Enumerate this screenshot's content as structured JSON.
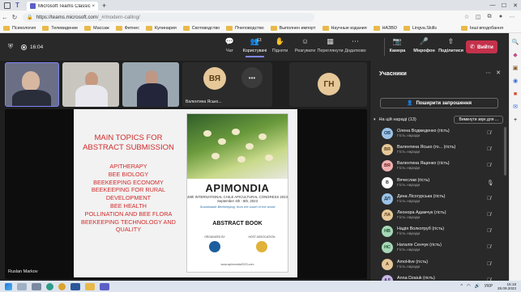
{
  "browser": {
    "tab_title": "Microsoft Teams Classic",
    "tab_close": "×",
    "new_tab": "+",
    "url_host": "https://teams.microsoft.com",
    "url_path": "/_#/modern-calling/",
    "bookmarks": [
      "Психология",
      "Телевидение",
      "Массаж",
      "Фитнес",
      "Кулинария",
      "Скотоводство",
      "Пчеловодство",
      "Выполнен импорт",
      "Научные издания",
      "НАЗВО",
      "Lingva.Skills"
    ],
    "bookmark_other": "Інші вподобання"
  },
  "meeting": {
    "timer": "16:04",
    "toolbar": [
      {
        "label": "Чат",
        "icon": "💬"
      },
      {
        "label": "Користувачі",
        "icon": "👥",
        "count": "13"
      },
      {
        "label": "Підняти",
        "icon": "✋"
      },
      {
        "label": "Реагувати",
        "icon": "☺"
      },
      {
        "label": "Переглянути",
        "icon": "▦"
      },
      {
        "label": "Додатково",
        "icon": "⋯"
      }
    ],
    "devices": [
      {
        "label": "Камера",
        "icon": "📷"
      },
      {
        "label": "Мікрофон",
        "icon": "🎤"
      },
      {
        "label": "Поділитися",
        "icon": "⇧"
      }
    ],
    "leave_label": "Вийти"
  },
  "stage": {
    "avatar_tile": {
      "initials": "ВЯ",
      "name": "Валентина Ясько..."
    },
    "more_tile": {
      "label": "•••",
      "caption": "Ще користувачі: 9 осіб"
    },
    "gn_tile": {
      "initials": "ГН"
    },
    "presenter": "Ruslan Markov"
  },
  "slide": {
    "title_line1": "MAIN TOPICS FOR",
    "title_line2": "ABSTRACT SUBMISSION",
    "topics": [
      "APITHERAPY",
      "BEE BIOLOGY",
      "BEEKEEPING ECONOMY",
      "BEEKEEPING FOR RURAL",
      "DEVELOPMENT",
      "BEE HEALTH",
      "POLLINATION AND BEE FLORA",
      "BEEKEEPING TECHNOLOGY AND",
      "QUALITY"
    ],
    "book": {
      "brand": "APIMONDIA",
      "subtitle": "48th INTERNATIONAL CHILE APICULTURAL CONGRESS 2023",
      "dates": "September 4th - 8th, 2023",
      "tagline": "Sustainable Beekeeping, from the south of the world",
      "heading": "ABSTRACT BOOK",
      "organized_by": "ORGANIZED BY",
      "host_association": "HOST ASSOCIATION",
      "url": "www.apimondia2023.com"
    }
  },
  "panel": {
    "title": "Учасники",
    "share_label": "Поширити запрошення",
    "section_label": "На цій нараді (13)",
    "mute_all": "Вимкнути звук для ...",
    "participants": [
      {
        "initials": "ОВ",
        "name": "Олена Водмеденко (гість)",
        "role": "Гість наради",
        "bg": "#9cc3e6",
        "fg": "#1d3b5a",
        "mic": "🎙̸"
      },
      {
        "initials": "ВЯ",
        "name": "Валентина Ясько (го... (гість)",
        "role": "Гість наради",
        "bg": "#e6c899",
        "fg": "#5a3e16",
        "mic": "🎙̸"
      },
      {
        "initials": "ВЯ",
        "name": "Валентина Ященко (гість)",
        "role": "Гість наради",
        "bg": "#f0b0b0",
        "fg": "#6a1e1e",
        "mic": "🎙̸"
      },
      {
        "initials": "В",
        "name": "Вячеслав (гість)",
        "role": "Гість наради",
        "bg": "#ffffff",
        "fg": "#333333",
        "mic": "🎙"
      },
      {
        "initials": "ДЛ",
        "name": "Дина Лісогурська (гість)",
        "role": "Гість наради",
        "bg": "#9cc3e6",
        "fg": "#1d3b5a",
        "mic": "🎙̸"
      },
      {
        "initials": "ЛА",
        "name": "Леонора Адамчук (гість)",
        "role": "Гість наради",
        "bg": "#e6c899",
        "fg": "#5a3e16",
        "mic": "🎙̸"
      },
      {
        "initials": "НВ",
        "name": "Надія Волкотруб (гість)",
        "role": "Гість наради",
        "bg": "#a6d8b8",
        "fg": "#1c4d2e",
        "mic": "🎙̸"
      },
      {
        "initials": "НС",
        "name": "Наталія Сенчук (гість)",
        "role": "Гість наради",
        "bg": "#a6d8b8",
        "fg": "#1c4d2e",
        "mic": "🎙̸"
      },
      {
        "initials": "А",
        "name": "AmoHive (гість)",
        "role": "Гість наради",
        "bg": "#e6c899",
        "fg": "#5a3e16",
        "mic": "🎙̸"
      },
      {
        "initials": "АД",
        "name": "Anna Dzaiuk (гість)",
        "role": "Гість наради",
        "bg": "#c8b8e6",
        "fg": "#3a2a5a",
        "mic": "🎙̸"
      }
    ]
  },
  "taskbar": {
    "lang": "УКР",
    "time": "15:18",
    "date": "28.09.2023"
  }
}
